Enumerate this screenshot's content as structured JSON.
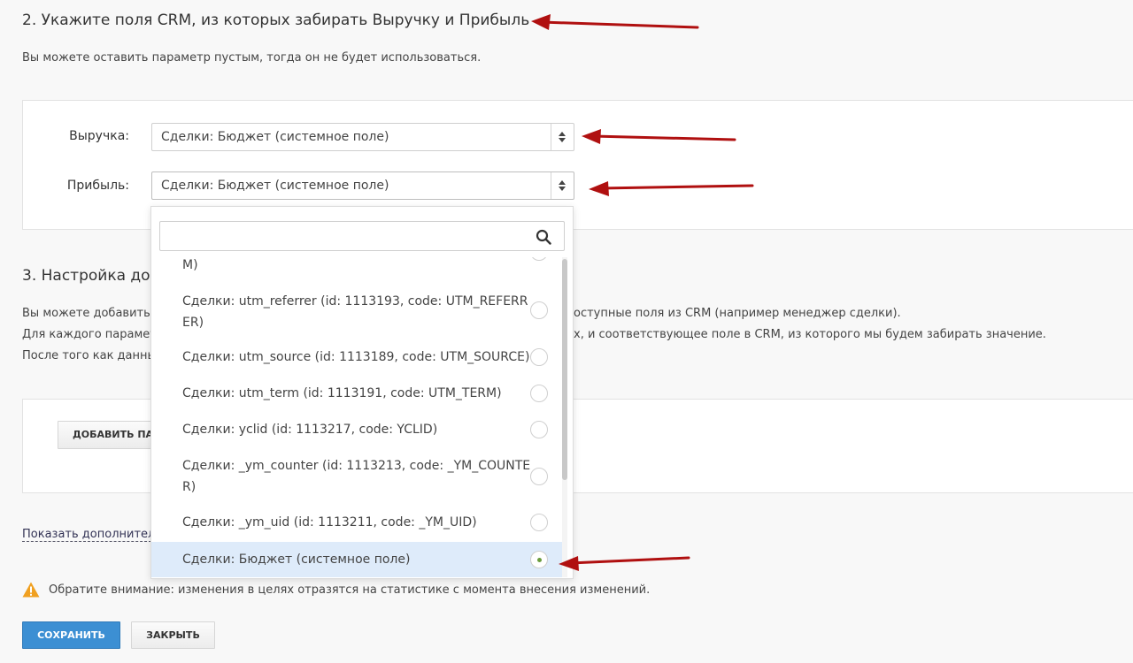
{
  "section2": {
    "title": "2. Укажите поля CRM, из которых забирать Выручку и Прибыль",
    "description": "Вы можете оставить параметр пустым, тогда он не будет использоваться.",
    "revenue_label": "Выручка:",
    "revenue_value": "Сделки: Бюджет (системное поле)",
    "profit_label": "Прибыль:",
    "profit_value": "Сделки: Бюджет (системное поле)"
  },
  "section3": {
    "title": "3. Настройка доп",
    "desc_line1_left": "Вы можете добавить д",
    "desc_line1_right": "оступные поля из CRM (например менеджер сделки).",
    "desc_line2_left": "Для каждого парамет",
    "desc_line2_right": "х, и соответствующее поле в CRM, из которого мы будем забирать значение.",
    "desc_line3_left": "После того как данны",
    "add_button": "ДОБАВИТЬ ПА"
  },
  "show_more_link": "Показать дополнительн",
  "notice": "Обратите внимание: изменения в целях отразятся на статистике с момента внесения изменений.",
  "buttons": {
    "save": "СОХРАНИТЬ",
    "close": "ЗАКРЫТЬ"
  },
  "dropdown": {
    "search_placeholder": "",
    "items": [
      {
        "label": "М)",
        "selected": false
      },
      {
        "label": "Сделки: utm_referrer (id: 1113193, code: UTM_REFERRER)",
        "selected": false
      },
      {
        "label": "Сделки: utm_source (id: 1113189, code: UTM_SOURCE)",
        "selected": false
      },
      {
        "label": "Сделки: utm_term (id: 1113191, code: UTM_TERM)",
        "selected": false
      },
      {
        "label": "Сделки: yclid (id: 1113217, code: YCLID)",
        "selected": false
      },
      {
        "label": "Сделки: _ym_counter (id: 1113213, code: _YM_COUNTER)",
        "selected": false
      },
      {
        "label": "Сделки: _ym_uid (id: 1113211, code: _YM_UID)",
        "selected": false
      },
      {
        "label": "Сделки: Бюджет (системное поле)",
        "selected": true
      }
    ]
  },
  "colors": {
    "annotation_arrow": "#b01010",
    "primary_button": "#3c8fd3",
    "selected_item_bg": "#deebfa",
    "warning": "#f0a020"
  },
  "icons": {
    "search": "search-icon",
    "warning": "warning-icon",
    "select_arrows": "select-arrows-icon",
    "annotation_arrow": "annotation-arrow-icon"
  }
}
